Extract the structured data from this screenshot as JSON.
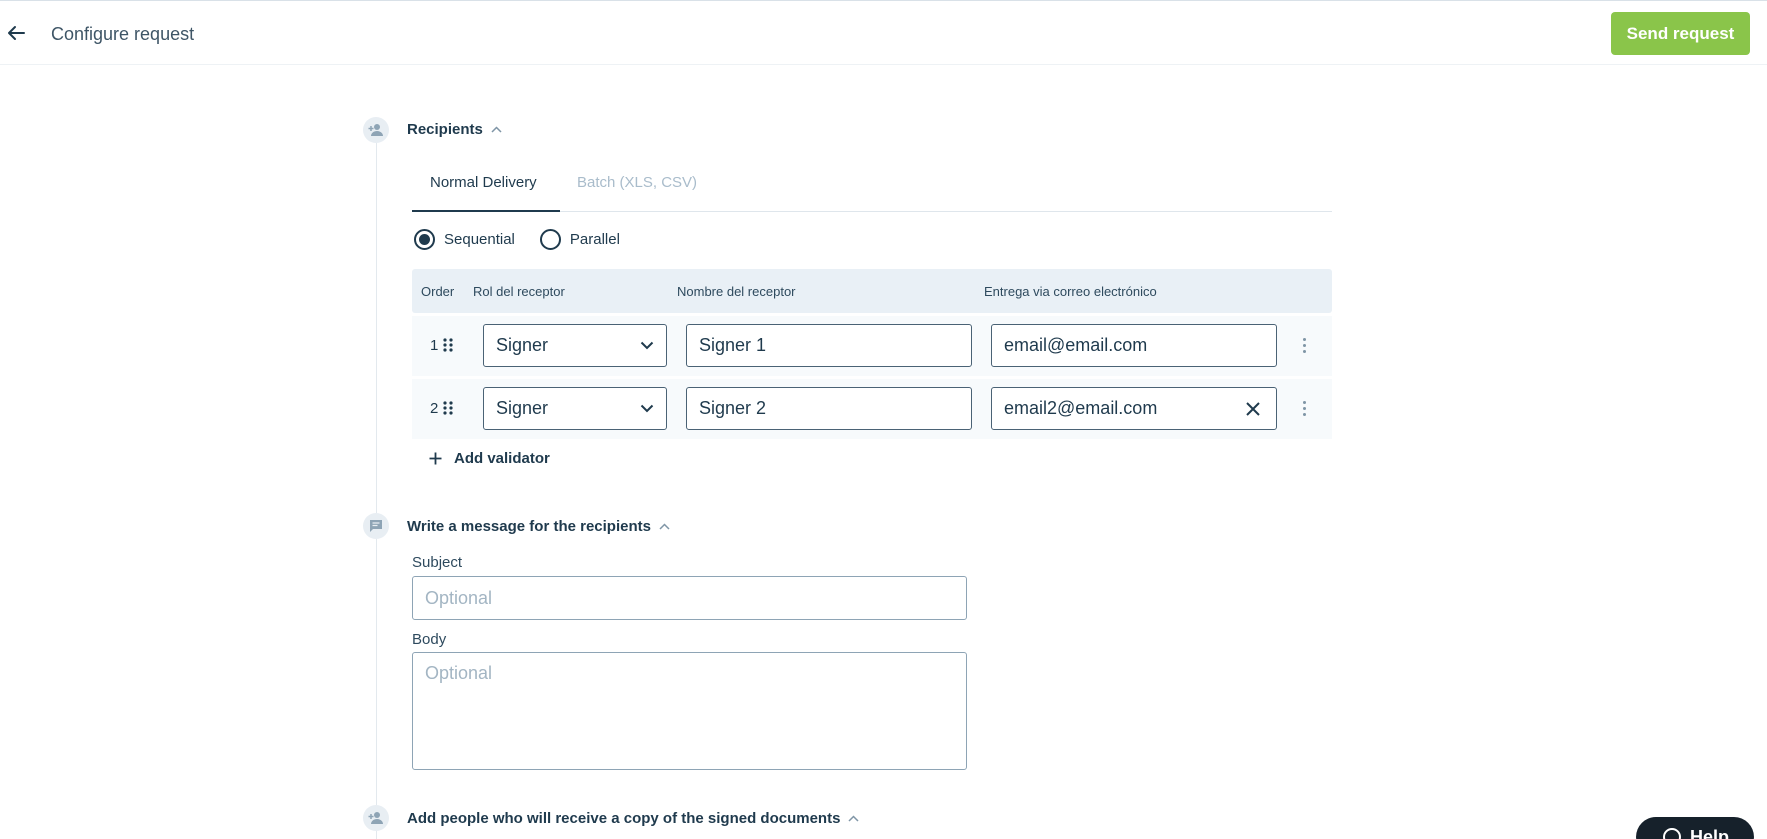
{
  "header": {
    "title": "Configure request",
    "send_label": "Send request"
  },
  "recipients": {
    "title": "Recipients",
    "tabs": [
      {
        "label": "Normal Delivery",
        "active": true
      },
      {
        "label": "Batch (XLS, CSV)",
        "active": false
      }
    ],
    "order_modes": [
      {
        "label": "Sequential",
        "selected": true
      },
      {
        "label": "Parallel",
        "selected": false
      }
    ],
    "columns": {
      "order": "Order",
      "role": "Rol del receptor",
      "name": "Nombre del receptor",
      "delivery": "Entrega via correo electrónico"
    },
    "rows": [
      {
        "order": "1",
        "role": "Signer",
        "name": "Signer 1",
        "email": "email@email.com"
      },
      {
        "order": "2",
        "role": "Signer",
        "name": "Signer 2",
        "email": "email2@email.com"
      }
    ],
    "add_validator_label": "Add validator"
  },
  "message": {
    "title": "Write a message for the recipients",
    "subject_label": "Subject",
    "subject_placeholder": "Optional",
    "body_label": "Body",
    "body_placeholder": "Optional"
  },
  "copy": {
    "title": "Add people who will receive a copy of the signed documents"
  },
  "help": {
    "label": "Help"
  },
  "colors": {
    "accent_green": "#8ac54a",
    "primary_text": "#1f3a4d",
    "muted_tab": "#a9bccb",
    "table_header_bg": "#e9f0f6"
  }
}
